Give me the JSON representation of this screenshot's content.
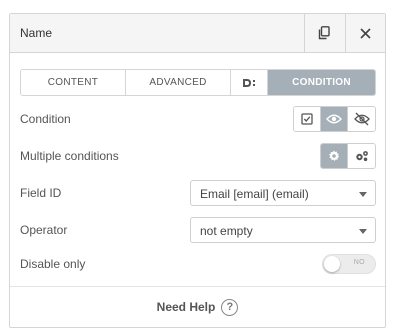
{
  "header": {
    "title": "Name"
  },
  "tabs": [
    {
      "label": "CONTENT"
    },
    {
      "label": "ADVANCED"
    },
    {
      "label": ""
    },
    {
      "label": "CONDITION"
    }
  ],
  "condition": {
    "label": "Condition",
    "options": [
      {
        "icon": "checkbox-icon"
      },
      {
        "icon": "eye-icon",
        "selected": true
      },
      {
        "icon": "eye-slash-icon"
      }
    ]
  },
  "multiple_conditions": {
    "label": "Multiple conditions",
    "options": [
      {
        "icon": "gear-icon",
        "selected": true
      },
      {
        "icon": "gears-icon"
      }
    ]
  },
  "field_id": {
    "label": "Field ID",
    "value": "Email [email] (email)"
  },
  "operator": {
    "label": "Operator",
    "value": "not empty"
  },
  "disable_only": {
    "label": "Disable only",
    "toggle_label": "NO",
    "on": false
  },
  "footer": {
    "help_text": "Need Help",
    "help_icon_text": "?"
  },
  "colors": {
    "active_tab": "#a4afb7",
    "header_bg": "#f5f5f5",
    "border": "#d5d5d5"
  }
}
